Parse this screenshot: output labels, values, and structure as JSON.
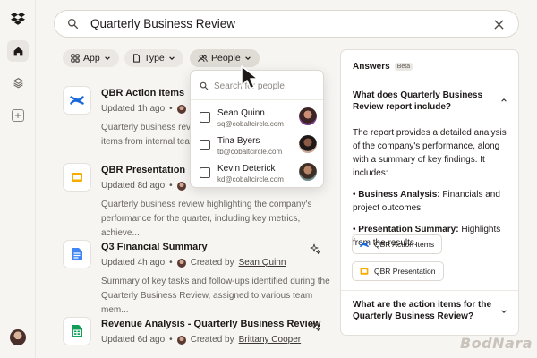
{
  "colors": {
    "background": "#f7f5f2",
    "panel": "#ffffff",
    "confluence_blue": "#1868db",
    "slides_yellow": "#f9ab00",
    "docs_blue": "#4285f4",
    "sheets_green": "#0f9d58"
  },
  "search": {
    "value": "Quarterly Business Review",
    "icons": [
      "search-icon",
      "close-icon"
    ]
  },
  "filters": [
    {
      "label": "App",
      "icon": "app-icon"
    },
    {
      "label": "Type",
      "icon": "file-icon"
    },
    {
      "label": "People",
      "icon": "people-icon"
    }
  ],
  "people_dropdown": {
    "search_placeholder": "Search for people",
    "people": [
      {
        "name": "Sean Quinn",
        "email": "sq@cobaltcircle.com",
        "checked": false
      },
      {
        "name": "Tina Byers",
        "email": "tb@cobaltcircle.com",
        "checked": false
      },
      {
        "name": "Kevin Deterick",
        "email": "kd@cobaltcircle.com",
        "checked": false
      }
    ]
  },
  "results": [
    {
      "title": "QBR Action Items",
      "meta": "Updated 1h ago",
      "separator": "•",
      "creator_prefix": "",
      "creator": "",
      "description": "Quarterly business revie... items from internal team...",
      "desc_line1": "Quarterly business revie",
      "desc_line2": "items from internal team",
      "icon": "confluence-icon"
    },
    {
      "title": "QBR Presentation",
      "meta": "Updated 8d ago",
      "separator": "•",
      "creator_prefix": "",
      "creator": "",
      "desc_line1": "Quarterly business review highlighting the company's",
      "desc_line2": "performance for the quarter, including key metrics, achieve...",
      "icon": "slides-icon"
    },
    {
      "title": "Q3 Financial Summary",
      "meta": "Updated 4h ago",
      "separator": "•",
      "creator_prefix": "Created by",
      "creator": "Sean Quinn",
      "desc_line1": "Summary of key tasks and follow-ups identified during the",
      "desc_line2": "Quarterly Business Review, assigned to various team mem...",
      "icon": "docs-icon"
    },
    {
      "title": "Revenue Analysis - Quarterly Business Review",
      "meta": "Updated 6d ago",
      "separator": "•",
      "creator_prefix": "Created by",
      "creator": "Brittany Cooper",
      "desc_line1": "",
      "desc_line2": "",
      "icon": "sheets-icon"
    }
  ],
  "answers": {
    "title": "Answers",
    "badge": "Beta",
    "question1": "What does Quarterly Business Review report include?",
    "intro": "The report provides a detailed analysis of the company's performance, along with a summary of key findings. It includes:",
    "bullet1_label": "Business Analysis:",
    "bullet1_text": " Financials and project outcomes.",
    "bullet2_label": "Presentation Summary:",
    "bullet2_text": " Highlights from the results.",
    "bullet_mark": "•",
    "sources": [
      {
        "label": "QBR Action Items",
        "icon": "confluence-icon"
      },
      {
        "label": "QBR Presentation",
        "icon": "slides-icon"
      }
    ],
    "question2": "What are the action items for the Quarterly Business Review?"
  },
  "watermark": "BodNara"
}
